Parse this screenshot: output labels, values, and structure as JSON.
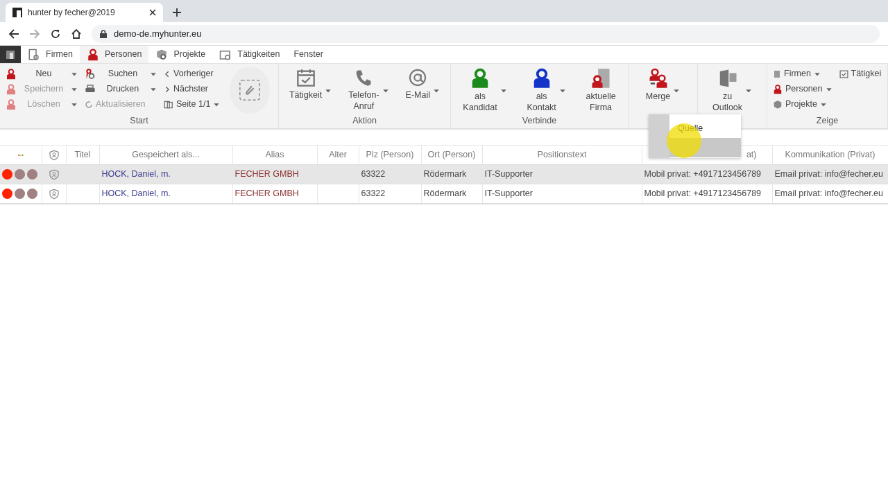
{
  "browser": {
    "tab_title": "hunter by fecher@2019",
    "url": "demo-de.myhunter.eu"
  },
  "app_tabs": [
    {
      "label": "Firmen",
      "selected": false
    },
    {
      "label": "Personen",
      "selected": true
    },
    {
      "label": "Projekte",
      "selected": false
    },
    {
      "label": "Tätigkeiten",
      "selected": false
    },
    {
      "label": "Fenster",
      "selected": false
    }
  ],
  "ribbon": {
    "groups": [
      {
        "label": "Start",
        "columns": [
          [
            {
              "label": "Neu",
              "disabled": false,
              "dropdown": true
            },
            {
              "label": "Speichern",
              "disabled": true,
              "dropdown": true
            },
            {
              "label": "Löschen",
              "disabled": true,
              "dropdown": true
            }
          ],
          [
            {
              "label": "Suchen",
              "disabled": false,
              "dropdown": true
            },
            {
              "label": "Drucken",
              "disabled": false,
              "dropdown": true
            },
            {
              "label": "Aktualisieren",
              "disabled": true,
              "dropdown": false
            }
          ],
          [
            {
              "label": "Vorheriger",
              "disabled": false,
              "dropdown": false
            },
            {
              "label": "Nächster",
              "disabled": false,
              "dropdown": false
            },
            {
              "label": "Seite 1/1",
              "disabled": false,
              "dropdown": true
            }
          ]
        ],
        "attach_button": true
      },
      {
        "label": "Aktion",
        "large": [
          {
            "label": "Tätigkeit",
            "dropdown": true
          },
          {
            "label": "Telefon-\nAnruf",
            "dropdown": true
          },
          {
            "label": "E-Mail",
            "dropdown": true
          }
        ]
      },
      {
        "label": "Verbinde",
        "large": [
          {
            "label": "als\nKandidat",
            "dropdown": true
          },
          {
            "label": "als\nKontakt",
            "dropdown": true
          },
          {
            "label": "aktuelle\nFirma",
            "dropdown": false
          }
        ]
      },
      {
        "large": [
          {
            "label": "Merge",
            "dropdown": true
          }
        ]
      },
      {
        "large": [
          {
            "label": "zu\nOutlook",
            "dropdown": true
          }
        ]
      },
      {
        "label": "Zeige",
        "columns": [
          [
            {
              "label": "Firmen",
              "disabled": false,
              "dropdown": true
            },
            {
              "label": "Personen",
              "disabled": false,
              "dropdown": true
            },
            {
              "label": "Projekte",
              "disabled": false,
              "dropdown": true
            }
          ],
          [
            {
              "label": "Tätigkei",
              "disabled": false,
              "dropdown": false
            }
          ]
        ]
      }
    ]
  },
  "merge_menu": {
    "items": [
      {
        "label": "Quelle",
        "selected": false
      },
      {
        "selected": true
      }
    ]
  },
  "table": {
    "columns": [
      "Titel",
      "Gespeichert als...",
      "Alias",
      "Alter",
      "Plz (Person)",
      "Ort (Person)",
      "Positionstext",
      "at)",
      "Kommunikation (Privat)"
    ],
    "rows": [
      {
        "selected": true,
        "dots": [
          {
            "color": "#ff2200"
          },
          {
            "color": "#a08080"
          },
          {
            "color": "#a08080"
          }
        ],
        "cells": [
          "",
          "HOCK, Daniel, m.",
          "FECHER GMBH",
          "",
          "63322",
          "Rödermark",
          "IT-Supporter",
          "Mobil privat: +4917123456789",
          "Email privat: info@fecher.eu"
        ]
      },
      {
        "selected": false,
        "dots": [
          {
            "color": "#ff2200"
          },
          {
            "color": "#a08080"
          },
          {
            "color": "#a08080"
          }
        ],
        "cells": [
          "",
          "HOCK, Daniel, m.",
          "FECHER GMBH",
          "",
          "63322",
          "Rödermark",
          "IT-Supporter",
          "Mobil privat: +4917123456789",
          "Email privat: info@fecher.eu"
        ]
      }
    ]
  }
}
